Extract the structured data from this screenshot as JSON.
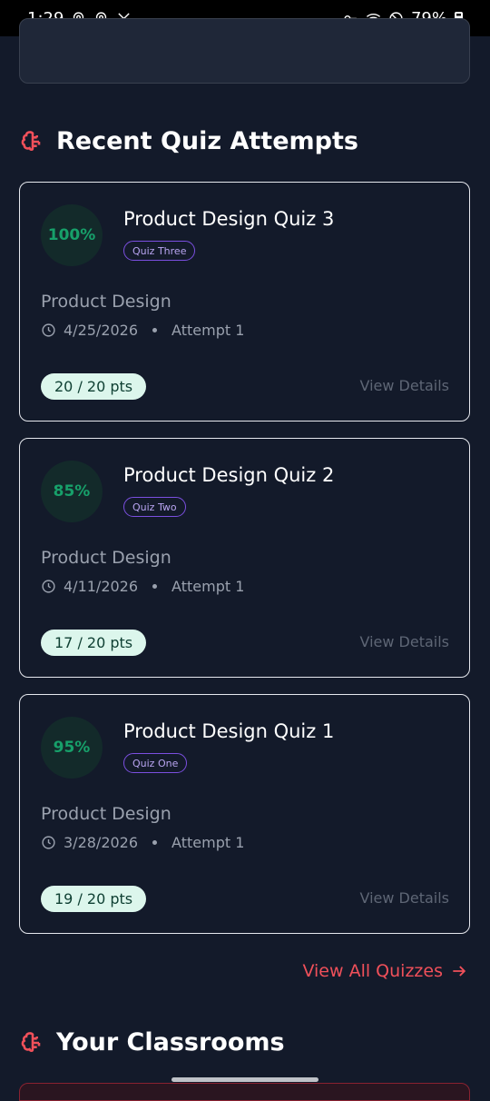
{
  "status_bar": {
    "time": "1:29",
    "battery": "79%",
    "icons": [
      "location-icon",
      "location-icon",
      "x-icon",
      "key-icon",
      "wifi-icon",
      "do-not-disturb-icon",
      "battery-icon"
    ]
  },
  "sections": {
    "recent_quizzes_title": "Recent Quiz Attempts",
    "classrooms_title": "Your Classrooms",
    "section_icon": "brain-icon"
  },
  "quizzes": [
    {
      "score": "100%",
      "title": "Product Design Quiz 3",
      "tag": "Quiz Three",
      "subject": "Product Design",
      "date": "4/25/2026",
      "attempt": "Attempt 1",
      "points": "20 / 20 pts",
      "action": "View Details"
    },
    {
      "score": "85%",
      "title": "Product Design Quiz 2",
      "tag": "Quiz Two",
      "subject": "Product Design",
      "date": "4/11/2026",
      "attempt": "Attempt 1",
      "points": "17 / 20 pts",
      "action": "View Details"
    },
    {
      "score": "95%",
      "title": "Product Design Quiz 1",
      "tag": "Quiz One",
      "subject": "Product Design",
      "date": "3/28/2026",
      "attempt": "Attempt 1",
      "points": "19 / 20 pts",
      "action": "View Details"
    }
  ],
  "view_all_label": "View All Quizzes",
  "colors": {
    "accent": "#f0505a",
    "score_green": "#17a06a",
    "tag_purple": "#7b4fe0",
    "background": "#131a2a"
  }
}
